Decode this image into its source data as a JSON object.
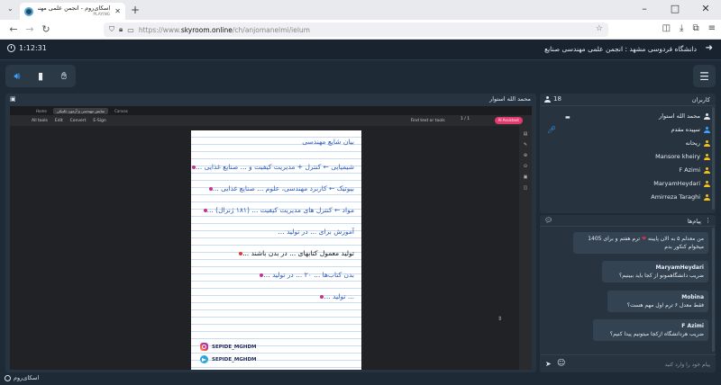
{
  "browser": {
    "tab_title": "اسکای‌روم - انجمن علمی مهندسی صنایع",
    "tab_subtitle": "PLAYING",
    "new_tab_icon": "plus-icon",
    "url_prefix": "https://www.",
    "url_host": "skyroom.online",
    "url_path": "/ch/anjomanelmi/ielum"
  },
  "app": {
    "timer": "1:12:31",
    "room_title": "دانشگاه فردوسی مشهد : انجمن علمی مهندسی صنایع",
    "accent_color": "#3aa3ff"
  },
  "presenter": {
    "name": "محمد الله استوار"
  },
  "shared_screen": {
    "tabs": [
      "Home",
      "نمایش مهندسی و آزمون تکنیکی",
      "Canvas"
    ],
    "menu": [
      "All tools",
      "Edit",
      "Convert",
      "E-Sign"
    ],
    "find_text": "Find text or tools",
    "page_label": "1 / 1",
    "assistant_label": "AI Assistant",
    "lines": [
      {
        "text": "بیان شایع مهندسی",
        "color": "#2e5ab8"
      },
      {
        "text": "شیمیایی ← کنترل + مدیریت کیفیت و ... صنایع غذایی ...",
        "color": "#2e5ab8"
      },
      {
        "text": "بیوتیک ← کاربرد مهندسی، علوم ... صنایع غذایی ...",
        "color": "#2e5ab8"
      },
      {
        "text": "مواد ← کنترل های مدیریت کیفیت ... (۱۸۱ ژنرال) ...",
        "color": "#2e5ab8"
      },
      {
        "text": "آموزش برای ... در تولید ...",
        "color": "#2e5ab8"
      },
      {
        "text": "تولید معمول کتابهای ... در بدن باشند ...",
        "color": "#111111"
      },
      {
        "text": "بدن کتاب‌ها ... ۲۰ ... در تولید ...",
        "color": "#2e5ab8"
      },
      {
        "text": "... تولید ...",
        "color": "#2e5ab8"
      }
    ],
    "social": [
      {
        "icon": "instagram-icon",
        "handle": "SEPIDE_MGHDM"
      },
      {
        "icon": "telegram-icon",
        "handle": "SEPIDE_MGHDM"
      }
    ]
  },
  "participants": {
    "title": "کاربران",
    "count": "18",
    "users": [
      {
        "name": "محمد الله استوار",
        "color": "#dfe6ee"
      },
      {
        "name": "سپیده مقدم",
        "color": "#3aa3ff"
      },
      {
        "name": "ریحانه",
        "color": "#f2c21b"
      },
      {
        "name": "Mansore kheiry",
        "color": "#f2c21b"
      },
      {
        "name": "F Azimi",
        "color": "#f2c21b"
      },
      {
        "name": "MaryamHeydari",
        "color": "#f2c21b"
      },
      {
        "name": "Amirreza Taraghi",
        "color": "#f2c21b"
      }
    ]
  },
  "chat": {
    "title": "پیام‌ها",
    "messages": [
      {
        "name": "",
        "pre_heart": "من معدلم ۵ به الان پایینه",
        "post_heart": "ترم هفتم و برای 1405 میخوام کنکور بدم"
      },
      {
        "name": "MaryamHeydari",
        "text": "ضریب دانشگاهمونو از کجا باید ببینیم؟"
      },
      {
        "name": "Mobina",
        "text": "فقط معدل ۶ ترم اول مهم هست؟"
      },
      {
        "name": "F Azimi",
        "text": "ضریب هردانشگاه ازکجا میتونیم پیدا کنیم؟"
      }
    ],
    "input_placeholder": "پیام خود را وارد کنید"
  },
  "footer": {
    "brand": "اسکای‌روم"
  }
}
